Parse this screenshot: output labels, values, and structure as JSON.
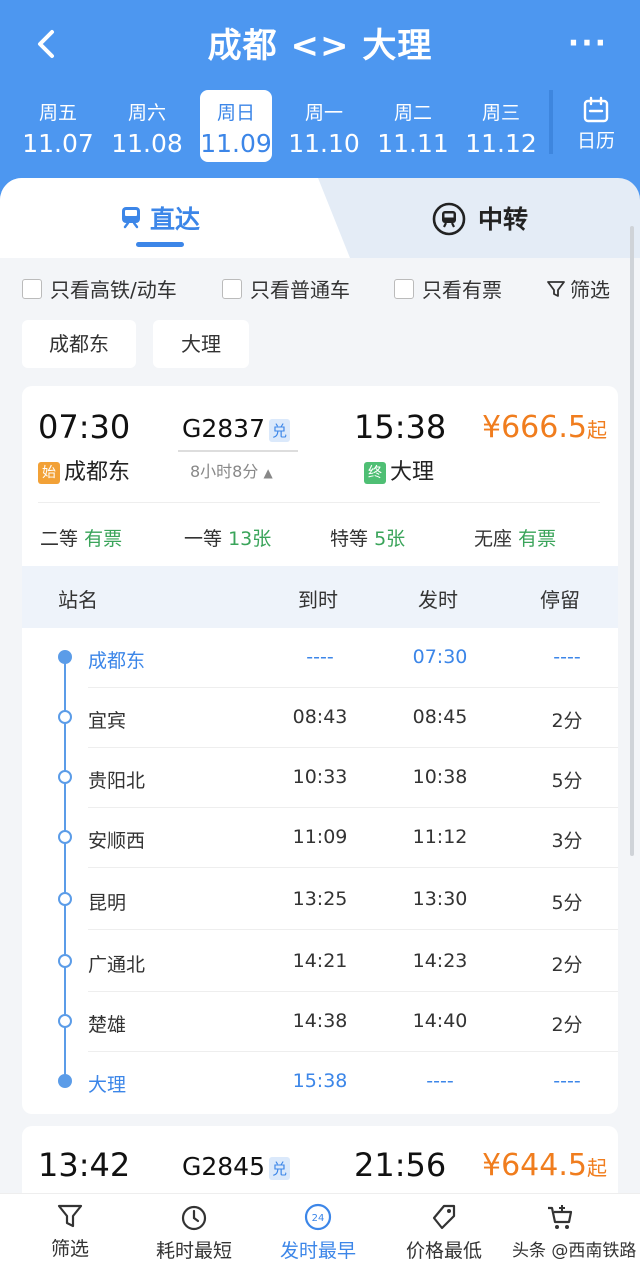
{
  "header": {
    "title": "成都 <> 大理",
    "more": "···"
  },
  "dates": [
    {
      "weekday": "周五",
      "date": "11.07"
    },
    {
      "weekday": "周六",
      "date": "11.08"
    },
    {
      "weekday": "周日",
      "date": "11.09",
      "active": true
    },
    {
      "weekday": "周一",
      "date": "11.10"
    },
    {
      "weekday": "周二",
      "date": "11.11"
    },
    {
      "weekday": "周三",
      "date": "11.12"
    }
  ],
  "calendar_label": "日历",
  "tabs": {
    "direct": "直达",
    "transfer": "中转"
  },
  "filters": {
    "high_speed": "只看高铁/动车",
    "normal": "只看普通车",
    "has_ticket": "只看有票",
    "filter": "筛选"
  },
  "station_chips": [
    "成都东",
    "大理"
  ],
  "train1": {
    "dep_time": "07:30",
    "train_no": "G2837",
    "dui": "兑",
    "duration": "8小时8分",
    "arr_time": "15:38",
    "price": "¥666.5",
    "price_suffix": "起",
    "start_badge": "始",
    "end_badge": "终",
    "from": "成都东",
    "to": "大理",
    "seats": [
      {
        "class": "二等",
        "status": "有票"
      },
      {
        "class": "一等",
        "status": "13张"
      },
      {
        "class": "特等",
        "status": "5张"
      },
      {
        "class": "无座",
        "status": "有票"
      }
    ],
    "table_headers": {
      "name": "站名",
      "arrive": "到时",
      "depart": "发时",
      "stop": "停留"
    },
    "stops": [
      {
        "name": "成都东",
        "arrive": "----",
        "depart": "07:30",
        "stop": "----"
      },
      {
        "name": "宜宾",
        "arrive": "08:43",
        "depart": "08:45",
        "stop": "2分"
      },
      {
        "name": "贵阳北",
        "arrive": "10:33",
        "depart": "10:38",
        "stop": "5分"
      },
      {
        "name": "安顺西",
        "arrive": "11:09",
        "depart": "11:12",
        "stop": "3分"
      },
      {
        "name": "昆明",
        "arrive": "13:25",
        "depart": "13:30",
        "stop": "5分"
      },
      {
        "name": "广通北",
        "arrive": "14:21",
        "depart": "14:23",
        "stop": "2分"
      },
      {
        "name": "楚雄",
        "arrive": "14:38",
        "depart": "14:40",
        "stop": "2分"
      },
      {
        "name": "大理",
        "arrive": "15:38",
        "depart": "----",
        "stop": "----"
      }
    ]
  },
  "train2": {
    "dep_time": "13:42",
    "train_no": "G2845",
    "dui": "兑",
    "arr_time": "21:56",
    "price": "¥644.5",
    "price_suffix": "起"
  },
  "bottom_bar": [
    {
      "label": "筛选",
      "icon": "filter-icon"
    },
    {
      "label": "耗时最短",
      "icon": "stopwatch-icon"
    },
    {
      "label": "发时最早",
      "icon": "clock-24-icon",
      "active": true
    },
    {
      "label": "价格最低",
      "icon": "price-tag-icon"
    },
    {
      "label": "",
      "icon": "cart-icon"
    }
  ],
  "watermark": "头条 @西南铁路",
  "colors": {
    "accent": "#3c86e8",
    "header": "#4d97f0",
    "price": "#f07d1e",
    "available": "#3aa45a"
  }
}
